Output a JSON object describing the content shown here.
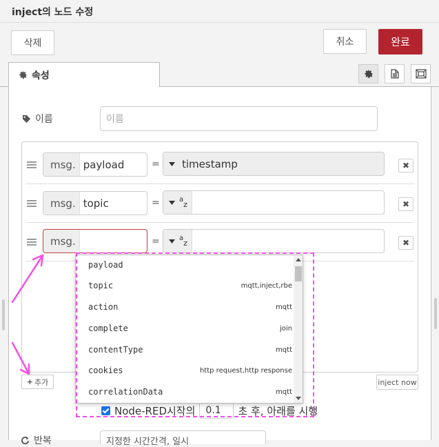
{
  "header": {
    "title": "inject의 노드 수정"
  },
  "toolbar": {
    "delete_label": "삭제",
    "cancel_label": "취소",
    "done_label": "완료"
  },
  "tabs": {
    "properties_label": "속성"
  },
  "name_field": {
    "label": "이름",
    "placeholder": "이름"
  },
  "props": {
    "rows": [
      {
        "prefix": "msg.",
        "key": "payload",
        "equals": "=",
        "value": "timestamp"
      },
      {
        "prefix": "msg.",
        "key": "topic",
        "equals": "=",
        "value": ""
      },
      {
        "prefix": "msg.",
        "key": "",
        "equals": "=",
        "value": ""
      }
    ],
    "az_top": "a",
    "az_bottom": "z",
    "delete_glyph": "✖"
  },
  "add_button": {
    "label": "추가"
  },
  "inject_now": {
    "label": "inject now"
  },
  "dropdown": {
    "items": [
      {
        "name": "payload",
        "tag": ""
      },
      {
        "name": "topic",
        "tag": "mqtt,inject,rbe"
      },
      {
        "name": "action",
        "tag": "mqtt"
      },
      {
        "name": "complete",
        "tag": "join"
      },
      {
        "name": "contentType",
        "tag": "mqtt"
      },
      {
        "name": "cookies",
        "tag": "http request,http response"
      },
      {
        "name": "correlationData",
        "tag": "mqtt"
      }
    ]
  },
  "once": {
    "label_before": "Node-RED시작의",
    "delay": "0.1",
    "label_after": "초 후, 아래를 시행"
  },
  "repeat": {
    "label": "반복",
    "value": "지정한 시간간격, 일시"
  },
  "colors": {
    "accent": "#b4242f",
    "annotation": "#f24fe6",
    "checkbox": "#1a73e8"
  }
}
